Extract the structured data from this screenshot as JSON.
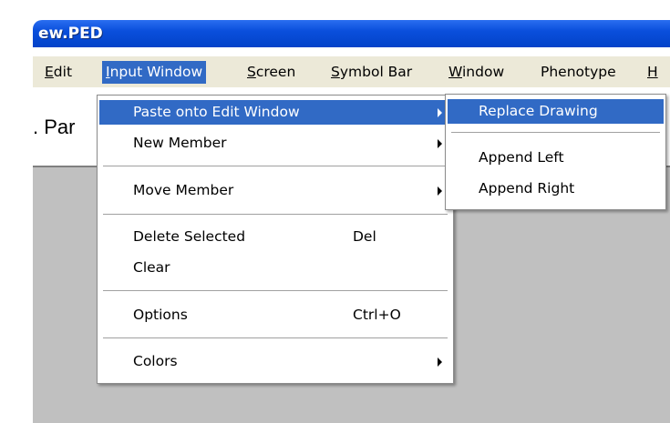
{
  "window": {
    "title": "ew.PED"
  },
  "menubar": {
    "items": [
      {
        "label": "Edit",
        "mnemonic": "E"
      },
      {
        "label": "Input Window",
        "mnemonic": "I"
      },
      {
        "label": "Screen",
        "mnemonic": "S"
      },
      {
        "label": "Symbol Bar",
        "mnemonic": "S"
      },
      {
        "label": "Window",
        "mnemonic": "W"
      },
      {
        "label": "Phenotype",
        "mnemonic": ""
      },
      {
        "label": "H",
        "mnemonic": "H"
      }
    ],
    "active": "Input Window"
  },
  "document": {
    "label": ". Par"
  },
  "input_window_menu": {
    "items": [
      {
        "label": "Paste onto Edit Window",
        "submenu": true,
        "highlighted": true
      },
      {
        "label": "New Member",
        "submenu": true
      },
      {
        "label": "Move Member",
        "submenu": true
      },
      {
        "label": "Delete Selected",
        "shortcut": "Del"
      },
      {
        "label": "Clear"
      },
      {
        "label": "Options",
        "shortcut": "Ctrl+O"
      },
      {
        "label": "Colors",
        "submenu": true
      }
    ]
  },
  "paste_submenu": {
    "items": [
      {
        "label": "Replace Drawing",
        "highlighted": true
      },
      {
        "label": "Append Left"
      },
      {
        "label": "Append Right"
      }
    ]
  },
  "colors": {
    "highlight": "#316ac5",
    "titlebar": "#0a4fdc",
    "menubar": "#ece9d8",
    "workspace": "#c0c0c0"
  }
}
